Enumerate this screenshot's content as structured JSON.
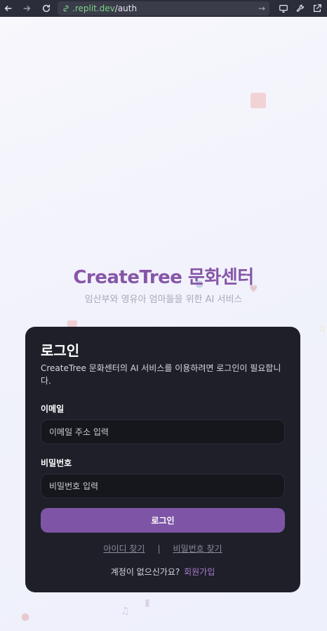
{
  "browser": {
    "url_domain": ".replit.dev",
    "url_path": "/auth",
    "url_go": "→"
  },
  "brand": {
    "title": "CreateTree 문화센터",
    "tagline": "임산부와 영유아 엄마들을 위한 AI 서비스",
    "accent_color": "#8656a8"
  },
  "login_card": {
    "title": "로그인",
    "description": "CreateTree 문화센터의 AI 서비스를 이용하려면 로그인이 필요합니다.",
    "email": {
      "label": "이메일",
      "placeholder": "이메일 주소 입력",
      "value": ""
    },
    "password": {
      "label": "비밀번호",
      "placeholder": "비밀번호 입력",
      "value": ""
    },
    "submit_label": "로그인",
    "find_id_label": "아이디 찾기",
    "separator": "|",
    "find_password_label": "비밀번호 찾기",
    "no_account_text": "계정이 없으신가요?",
    "signup_label": "회원가입",
    "button_color": "#7e55a6"
  }
}
